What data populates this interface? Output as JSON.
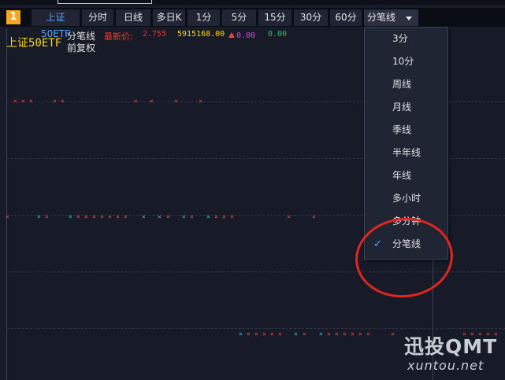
{
  "badge": "1",
  "toolbar": {
    "items": [
      "上证50ETF",
      "分时",
      "日线",
      "多日K",
      "1分",
      "5分",
      "15分",
      "30分",
      "60分"
    ],
    "period_select": "分笔线"
  },
  "info": {
    "name": "上证50ETF",
    "adjust": "前复权",
    "chart_type": "分笔线",
    "price_label": "最新价:",
    "price": "2.755",
    "volume": "5915168.00",
    "change": "0.00",
    "change_pct": "0.00"
  },
  "dropdown": {
    "items": [
      "3分",
      "10分",
      "周线",
      "月线",
      "季线",
      "半年线",
      "年线",
      "多小时",
      "多分钟",
      "分笔线"
    ],
    "selected": "分笔线",
    "check_glyph": "✓"
  },
  "colors": {
    "background": "#171b28",
    "accent": "#5aa2ff",
    "up": "#ff4040",
    "cyan": "#2ec6c6",
    "badge": "#f5a623",
    "annotation": "#e0261e",
    "price_value": "#ffd700",
    "change_magenta": "#e040e0",
    "change_pct_green": "#20c060"
  },
  "marks": {
    "glyph": "×"
  },
  "watermark": {
    "brand": "迅投QMT",
    "url": "xuntou.net"
  }
}
